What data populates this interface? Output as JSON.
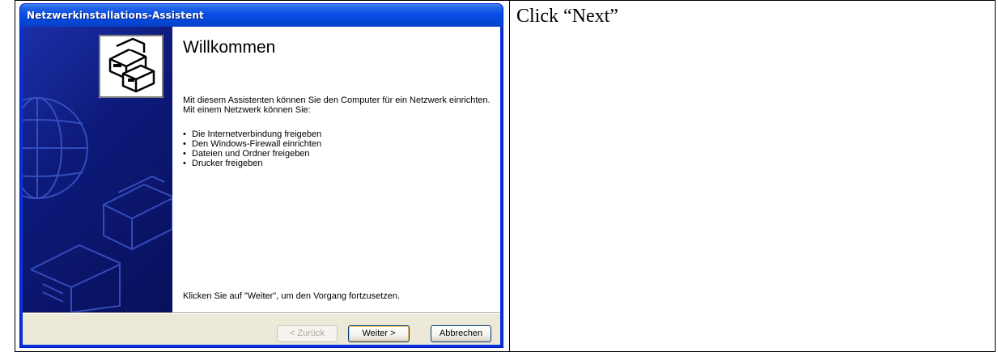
{
  "wizard": {
    "title": "Netzwerkinstallations-Assistent",
    "heading": "Willkommen",
    "intro": "Mit diesem Assistenten können Sie den Computer für ein Netzwerk einrichten. Mit einem Netzwerk können Sie:",
    "features": [
      "Die Internetverbindung freigeben",
      "Den Windows-Firewall einrichten",
      "Dateien und Ordner freigeben",
      "Drucker freigeben"
    ],
    "continue_hint": "Klicken Sie auf \"Weiter\", um den Vorgang fortzusetzen.",
    "buttons": {
      "back": "< Zurück",
      "next": "Weiter >",
      "cancel": "Abbrechen"
    },
    "icon": "network-computers-icon",
    "banner": "network-banner-graphic"
  },
  "instruction": {
    "text": "Click “Next”"
  },
  "colors": {
    "title_bar": "#0a4ee6",
    "banner": "#0d1a7a",
    "dialog_face": "#ece9d8"
  }
}
